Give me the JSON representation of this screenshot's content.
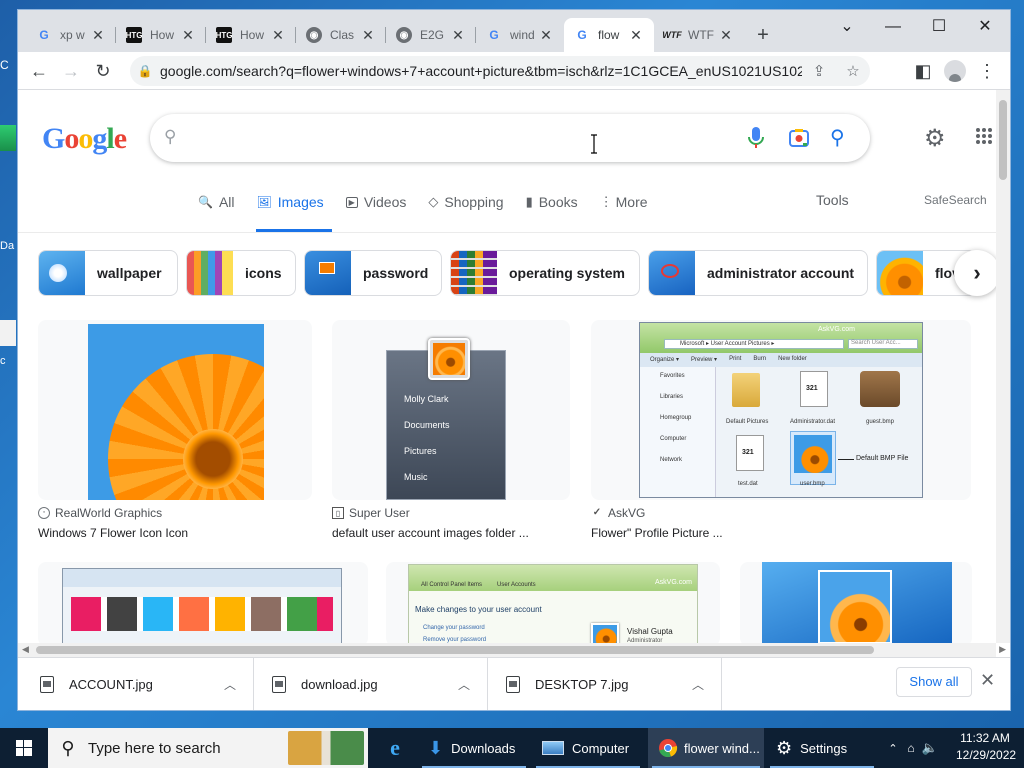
{
  "desktop": {
    "side_glyphs": [
      "C",
      "Da",
      "c"
    ]
  },
  "tabs": [
    {
      "favicon": "google-favicon",
      "title": "xp w",
      "active": false
    },
    {
      "favicon": "htg-favicon",
      "title": "How",
      "active": false
    },
    {
      "favicon": "htg-favicon",
      "title": "How",
      "active": false
    },
    {
      "favicon": "globe-favicon",
      "title": "Clas",
      "active": false
    },
    {
      "favicon": "globe-favicon",
      "title": "E2G",
      "active": false
    },
    {
      "favicon": "google-favicon",
      "title": "wind",
      "active": false
    },
    {
      "favicon": "google-favicon",
      "title": "flow",
      "active": true
    },
    {
      "favicon": "wtf-favicon",
      "title": "WTF",
      "active": false
    }
  ],
  "favicon_text": {
    "google": "G",
    "htg": "HTG",
    "globe": "◉",
    "wtf": "WTF"
  },
  "window_controls": {
    "chevron": "⌄",
    "minimize": "—",
    "maximize": "☐",
    "close": "✕"
  },
  "toolbar": {
    "url": "google.com/search?q=flower+windows+7+account+picture&tbm=isch&rlz=1C1GCEA_enUS1021US1021..."
  },
  "search": {
    "query": "",
    "nav_tabs": [
      {
        "label": "All",
        "icon": "search-icon",
        "glyph": "🔍"
      },
      {
        "label": "Images",
        "icon": "image-icon",
        "glyph": "🖼"
      },
      {
        "label": "Videos",
        "icon": "play-icon",
        "glyph": "▶"
      },
      {
        "label": "Shopping",
        "icon": "tag-icon",
        "glyph": "◇"
      },
      {
        "label": "Books",
        "icon": "book-icon",
        "glyph": "▮"
      },
      {
        "label": "More",
        "icon": "more-vert-icon",
        "glyph": "⋮"
      }
    ],
    "active_tab": "Images",
    "tools": "Tools",
    "safesearch": "SafeSearch"
  },
  "chips": [
    {
      "label": "wallpaper",
      "thumb": "blue"
    },
    {
      "label": "icons",
      "thumb": "grid"
    },
    {
      "label": "password",
      "thumb": "blue"
    },
    {
      "label": "operating system",
      "thumb": "grid"
    },
    {
      "label": "administrator account",
      "thumb": "blue"
    },
    {
      "label": "flov",
      "thumb": "orange"
    }
  ],
  "results": [
    {
      "source": "RealWorld Graphics",
      "title": "Windows 7 Flower Icon Icon"
    },
    {
      "source": "Super User",
      "title": "default user account images folder ..."
    },
    {
      "source": "AskVG",
      "title": "Flower\" Profile Picture ..."
    }
  ],
  "result_images": {
    "startmenu": {
      "entries": [
        "Molly Clark",
        "Documents",
        "Pictures",
        "Music"
      ]
    },
    "explorer": {
      "watermark": "AskVG.com",
      "path": "Microsoft ▸ User Account Pictures ▸",
      "search_placeholder": "Search User Acc...",
      "menu": [
        "Organize ▾",
        "Preview ▾",
        "Print",
        "Burn",
        "New folder"
      ],
      "nav": [
        "Favorites",
        "Libraries",
        "Homegroup",
        "Computer",
        "Network"
      ],
      "files": [
        {
          "name": "Default Pictures",
          "kind": "folder"
        },
        {
          "name": "Administrator.dat",
          "kind": "dat",
          "number": "321"
        },
        {
          "name": "guest.bmp",
          "kind": "bag"
        },
        {
          "name": "test.dat",
          "kind": "dat",
          "number": "321"
        },
        {
          "name": "user.bmp",
          "kind": "flower"
        }
      ],
      "callout": "Default BMP File"
    },
    "useraccounts": {
      "watermark": "AskVG.com",
      "breadcrumb": [
        "All Control Panel Items",
        "User Accounts"
      ],
      "heading": "Make changes to your user account",
      "links": [
        "Change your password",
        "Remove your password"
      ],
      "user": {
        "name": "Vishal Gupta",
        "role": "Administrator"
      }
    }
  },
  "downloads": [
    {
      "name": "ACCOUNT.jpg"
    },
    {
      "name": "download.jpg"
    },
    {
      "name": "DESKTOP 7.jpg"
    }
  ],
  "downloads_bar": {
    "show_all": "Show all"
  },
  "taskbar": {
    "search_placeholder": "Type here to search",
    "apps": [
      {
        "label": "",
        "icon": "ie-icon"
      },
      {
        "label": "Downloads",
        "icon": "downloads-icon"
      },
      {
        "label": "Computer",
        "icon": "computer-icon"
      },
      {
        "label": "flower wind...",
        "icon": "chrome-icon"
      },
      {
        "label": "Settings",
        "icon": "settings-icon"
      }
    ],
    "time": "11:32 AM",
    "date": "12/29/2022"
  },
  "colors": {
    "accent": "#1a73e8",
    "google_blue": "#4285f4",
    "google_red": "#ea4335",
    "google_yellow": "#fbbc05",
    "google_green": "#34a853",
    "taskbar": "#0d1f33"
  }
}
